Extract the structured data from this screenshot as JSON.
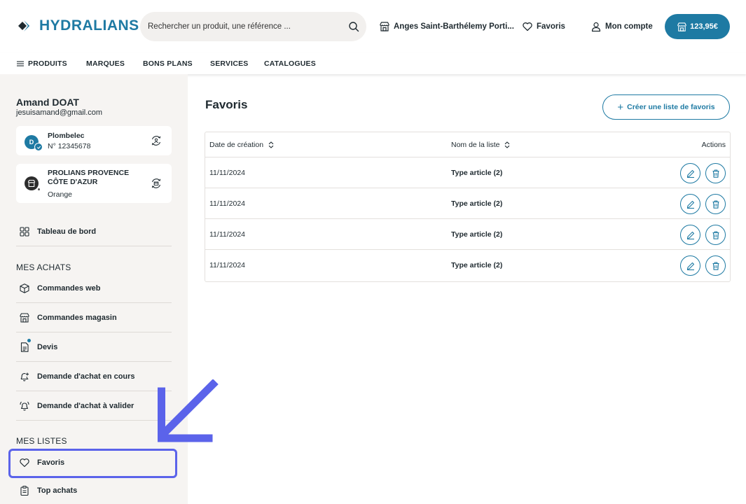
{
  "header": {
    "brand": "HYDRALIANS",
    "search_placeholder": "Rechercher un produit, une référence ...",
    "store_label": "Anges Saint-Barthélemy Porti...",
    "favorites_label": "Favoris",
    "account_label": "Mon compte",
    "cart_total": "123,95€"
  },
  "nav": {
    "items": [
      "PRODUITS",
      "MARQUES",
      "BONS PLANS",
      "SERVICES",
      "CATALOGUES"
    ]
  },
  "sidebar": {
    "user_name": "Amand DOAT",
    "user_email": "jesuisamand@gmail.com",
    "account_card": {
      "avatar_letter": "D",
      "name": "Plombelec",
      "number": "N° 12345678"
    },
    "store_card": {
      "line1": "PROLIANS PROVENCE",
      "line2": "CÔTE D'AZUR",
      "city": "Orange"
    },
    "dashboard": "Tableau de bord",
    "purchases_title": "MES ACHATS",
    "purchases": [
      "Commandes web",
      "Commandes magasin",
      "Devis",
      "Demande d'achat en cours",
      "Demande d'achat à valider"
    ],
    "lists_title": "MES LISTES",
    "lists": [
      "Favoris",
      "Top achats"
    ]
  },
  "main": {
    "title": "Favoris",
    "create_button": "Créer une liste de favoris",
    "columns": {
      "date": "Date de création",
      "name": "Nom de la liste",
      "actions": "Actions"
    },
    "rows": [
      {
        "date": "11/11/2024",
        "name": "Type article (2)"
      },
      {
        "date": "11/11/2024",
        "name": "Type article (2)"
      },
      {
        "date": "11/11/2024",
        "name": "Type article (2)"
      },
      {
        "date": "11/11/2024",
        "name": "Type article (2)"
      }
    ]
  },
  "colors": {
    "brand": "#1e7aa3",
    "sidebar_bg": "#f6f4f2",
    "annotation": "#5b63ea"
  }
}
